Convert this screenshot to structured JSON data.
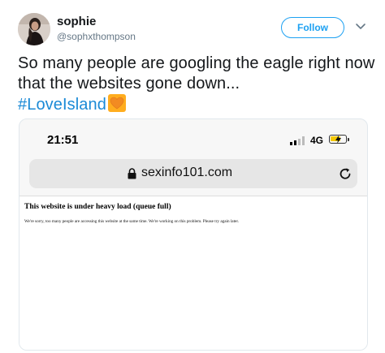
{
  "user": {
    "name": "sophie",
    "handle": "@sophxthompson"
  },
  "actions": {
    "follow_label": "Follow"
  },
  "tweet": {
    "text": "So many people are googling the eagle right now that the websites gone down...",
    "hashtag": "#LoveIsland",
    "emoji": "orange-heart-emoji"
  },
  "screenshot": {
    "status_bar": {
      "time": "21:51",
      "network": "4G"
    },
    "browser": {
      "url": "sexinfo101.com"
    },
    "page": {
      "title": "This website is under heavy load (queue full)",
      "body": "We're sorry, too many people are accessing this website at the same time. We're working on this problem. Please try again later."
    }
  },
  "colors": {
    "accent": "#1da1f2",
    "hashtag": "#1b8ad6",
    "emoji_bg": "#ffad1f"
  }
}
